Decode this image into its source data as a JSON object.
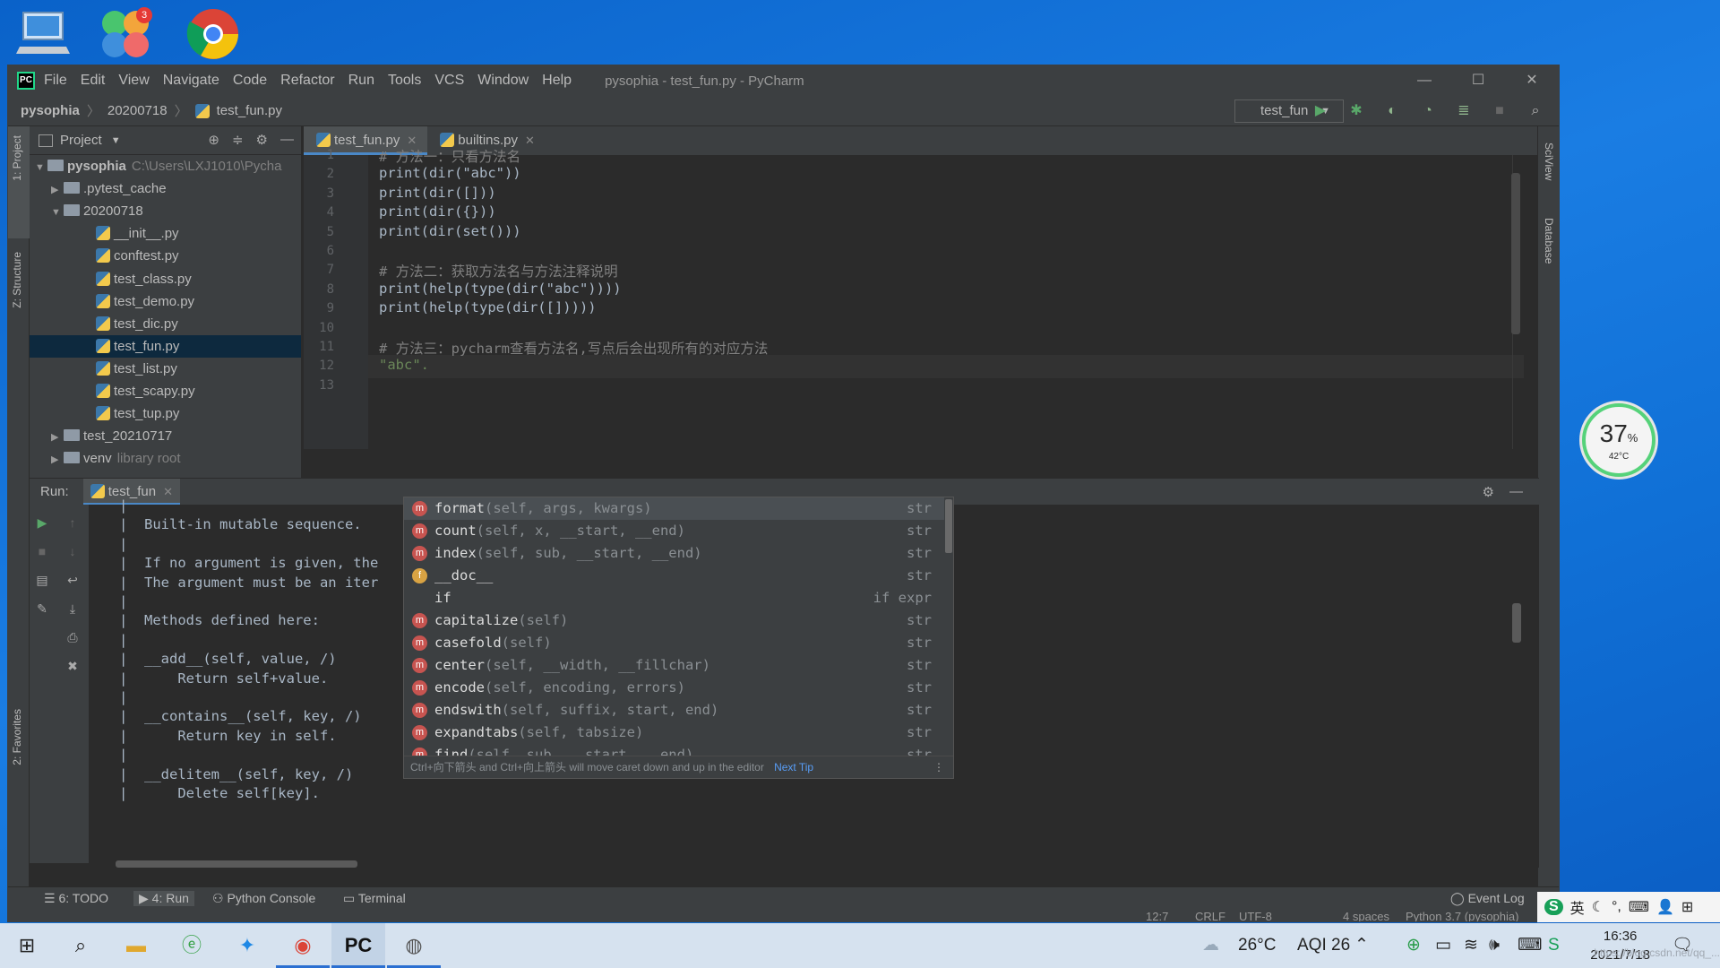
{
  "desktop": {
    "icons": [
      "this-pc-icon",
      "app-store-icon",
      "chrome-icon"
    ],
    "app_badge": "3"
  },
  "window": {
    "title": "pysophia - test_fun.py - PyCharm",
    "menu": [
      "File",
      "Edit",
      "View",
      "Navigate",
      "Code",
      "Refactor",
      "Run",
      "Tools",
      "VCS",
      "Window",
      "Help"
    ],
    "controls": [
      "—",
      "☐",
      "✕"
    ]
  },
  "navbar": {
    "breadcrumb": [
      "pysophia",
      "20200718",
      "test_fun.py"
    ],
    "run_config": "test_fun"
  },
  "sidebar_left": {
    "project_label": "1: Project",
    "structure_label": "Z: Structure",
    "favorites_label": "2: Favorites"
  },
  "sidebar_right": {
    "sciview_label": "SciView",
    "database_label": "Database"
  },
  "project_panel": {
    "title": "Project",
    "tree": [
      {
        "arrow": "▼",
        "kind": "folder",
        "name": "pysophia",
        "note": "C:\\Users\\LXJ1010\\Pycha"
      },
      {
        "arrow": "▶",
        "kind": "folder",
        "name": ".pytest_cache",
        "note": ""
      },
      {
        "arrow": "▼",
        "kind": "folder",
        "name": "20200718",
        "note": ""
      },
      {
        "arrow": "",
        "kind": "py",
        "name": "__init__.py",
        "note": ""
      },
      {
        "arrow": "",
        "kind": "py",
        "name": "conftest.py",
        "note": ""
      },
      {
        "arrow": "",
        "kind": "py",
        "name": "test_class.py",
        "note": ""
      },
      {
        "arrow": "",
        "kind": "py",
        "name": "test_demo.py",
        "note": ""
      },
      {
        "arrow": "",
        "kind": "py",
        "name": "test_dic.py",
        "note": ""
      },
      {
        "arrow": "",
        "kind": "py",
        "name": "test_fun.py",
        "note": ""
      },
      {
        "arrow": "",
        "kind": "py",
        "name": "test_list.py",
        "note": ""
      },
      {
        "arrow": "",
        "kind": "py",
        "name": "test_scapy.py",
        "note": ""
      },
      {
        "arrow": "",
        "kind": "py",
        "name": "test_tup.py",
        "note": ""
      },
      {
        "arrow": "▶",
        "kind": "folder",
        "name": "test_20210717",
        "note": ""
      },
      {
        "arrow": "▶",
        "kind": "folder",
        "name": "venv",
        "note": "library root"
      }
    ],
    "selected_index": 8
  },
  "editor": {
    "tabs": [
      {
        "label": "test_fun.py",
        "active": true
      },
      {
        "label": "builtins.py",
        "active": false
      }
    ],
    "line_numbers": [
      "1",
      "2",
      "3",
      "4",
      "5",
      "6",
      "7",
      "8",
      "9",
      "10",
      "11",
      "12",
      "13"
    ],
    "code": [
      "# 方法一：只看方法名",
      "print(dir(\"abc\"))",
      "print(dir([]))",
      "print(dir({}))",
      "print(dir(set()))",
      "",
      "# 方法二：获取方法名与方法注释说明",
      "print(help(type(dir(\"abc\"))))",
      "print(help(type(dir([]))))",
      "",
      "# 方法三：pycharm查看方法名,写点后会出现所有的对应方法",
      "\"abc\".",
      ""
    ]
  },
  "autocomplete": {
    "items": [
      {
        "icon": "m",
        "name": "format",
        "args": "(self, args, kwargs)",
        "type": "str"
      },
      {
        "icon": "m",
        "name": "count",
        "args": "(self, x, __start, __end)",
        "type": "str"
      },
      {
        "icon": "m",
        "name": "index",
        "args": "(self, sub, __start, __end)",
        "type": "str"
      },
      {
        "icon": "f",
        "name": "__doc__",
        "args": "",
        "type": "str"
      },
      {
        "icon": "",
        "name": "if",
        "args": "",
        "type": "if expr"
      },
      {
        "icon": "m",
        "name": "capitalize",
        "args": "(self)",
        "type": "str"
      },
      {
        "icon": "m",
        "name": "casefold",
        "args": "(self)",
        "type": "str"
      },
      {
        "icon": "m",
        "name": "center",
        "args": "(self, __width, __fillchar)",
        "type": "str"
      },
      {
        "icon": "m",
        "name": "encode",
        "args": "(self, encoding, errors)",
        "type": "str"
      },
      {
        "icon": "m",
        "name": "endswith",
        "args": "(self, suffix, start, end)",
        "type": "str"
      },
      {
        "icon": "m",
        "name": "expandtabs",
        "args": "(self, tabsize)",
        "type": "str"
      },
      {
        "icon": "m",
        "name": "find",
        "args": "(self, sub, __start, __end)",
        "type": "str"
      }
    ],
    "footer_hint": "Ctrl+向下箭头 and Ctrl+向上箭头 will move caret down and up in the editor",
    "footer_link": "Next Tip"
  },
  "run_panel": {
    "label": "Run:",
    "tab": "test_fun",
    "console": [
      "|",
      "|  Built-in mutable sequence.",
      "|",
      "|  If no argument is given, the",
      "|  The argument must be an iter",
      "|",
      "|  Methods defined here:",
      "|",
      "|  __add__(self, value, /)",
      "|      Return self+value.",
      "|",
      "|  __contains__(self, key, /)",
      "|      Return key in self.",
      "|",
      "|  __delitem__(self, key, /)",
      "|      Delete self[key]."
    ]
  },
  "toolwindows": {
    "todo": "6: TODO",
    "run": "4: Run",
    "python_console": "Python Console",
    "terminal": "Terminal",
    "event_log": "Event Log"
  },
  "statusbar": {
    "position": "12:7",
    "line_sep": "CRLF",
    "encoding": "UTF-8",
    "indent": "4 spaces",
    "interpreter": "Python 3.7 (pysophia)"
  },
  "gauge": {
    "percent": "37",
    "percent_sign": "%",
    "temp": "42°C"
  },
  "ime": {
    "lang": "英"
  },
  "taskbar": {
    "weather": "26°C",
    "aqi": "AQI 26",
    "time": "16:36",
    "date": "2021/7/18",
    "watermark": "https://blog.csdn.net/qq_..."
  }
}
